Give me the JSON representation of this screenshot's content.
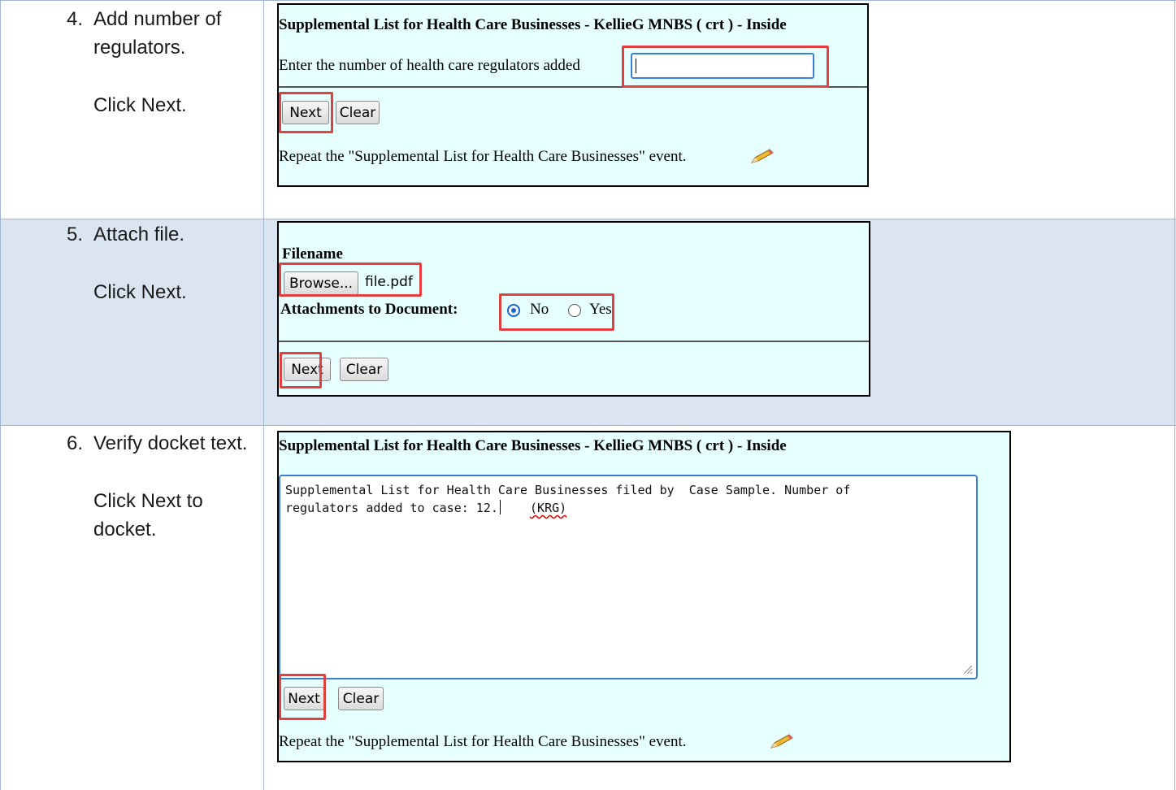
{
  "steps": [
    {
      "number": "4.",
      "instruction": "Add number of regulators.",
      "action": "Click Next."
    },
    {
      "number": "5.",
      "instruction": "Attach file.",
      "action": "Click Next."
    },
    {
      "number": "6.",
      "instruction": "Verify docket text.",
      "action": "Click Next to docket."
    }
  ],
  "panel1": {
    "title": "Supplemental List for Health Care Businesses - KellieG MNBS ( crt ) - Inside",
    "field_label": "Enter the number of health care regulators added",
    "field_value": "",
    "next_label": "Next",
    "clear_label": "Clear",
    "repeat_text": "Repeat the \"Supplemental List for Health Care Businesses\" event."
  },
  "panel2": {
    "filename_label": "Filename",
    "browse_label": "Browse...",
    "file_name": "file.pdf",
    "attachments_label": "Attachments to Document:",
    "radio_no": "No",
    "radio_yes": "Yes",
    "selected": "No",
    "next_label": "Next",
    "clear_label": "Clear"
  },
  "panel3": {
    "title": "Supplemental List for Health Care Businesses - KellieG MNBS ( crt ) - Inside",
    "docket_text_main": "Supplemental List for Health Care Businesses filed by  Case Sample. Number of\nregulators added to case: 12.",
    "docket_text_tail": "(KRG)",
    "next_label": "Next",
    "clear_label": "Clear",
    "repeat_text": "Repeat the \"Supplemental List for Health Care Businesses\" event."
  },
  "icons": {
    "edit": "pencil-icon"
  },
  "colors": {
    "panel_bg": "#e6ffff",
    "highlight": "#e04040",
    "row_shade": "#dbe5f1"
  }
}
